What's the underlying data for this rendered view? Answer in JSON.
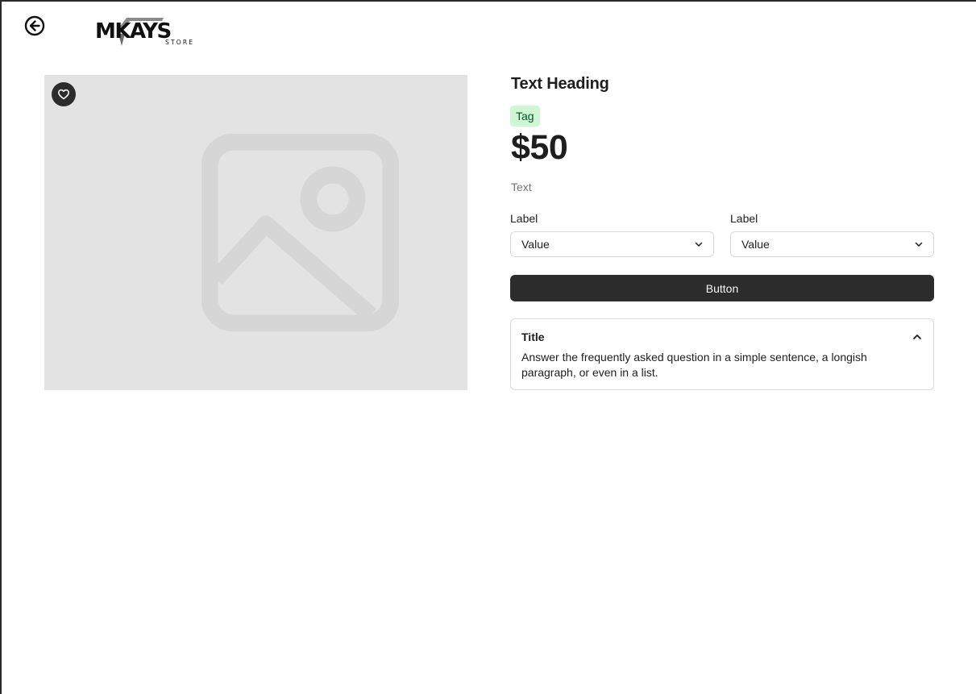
{
  "header": {
    "back_icon": "arrow-left-circle-icon",
    "logo_text": "MKAYS",
    "logo_subtext": "STORE"
  },
  "media": {
    "placeholder_icon": "image-placeholder-icon",
    "favorite_icon": "heart-icon"
  },
  "product": {
    "heading": "Text Heading",
    "tag": "Tag",
    "price": "$50",
    "text": "Text"
  },
  "fields": [
    {
      "label": "Label",
      "value": "Value"
    },
    {
      "label": "Label",
      "value": "Value"
    }
  ],
  "button": {
    "label": "Button"
  },
  "accordion": {
    "title": "Title",
    "body": "Answer the frequently asked question in a simple sentence, a longish paragraph, or even in a list.",
    "expanded": true
  },
  "colors": {
    "dark": "#2c2c2c",
    "tag_bg": "#cff7d3",
    "tag_text": "#02542d",
    "image_bg": "#e3e3e3",
    "muted_text": "#757575",
    "border": "#d9d9d9"
  }
}
